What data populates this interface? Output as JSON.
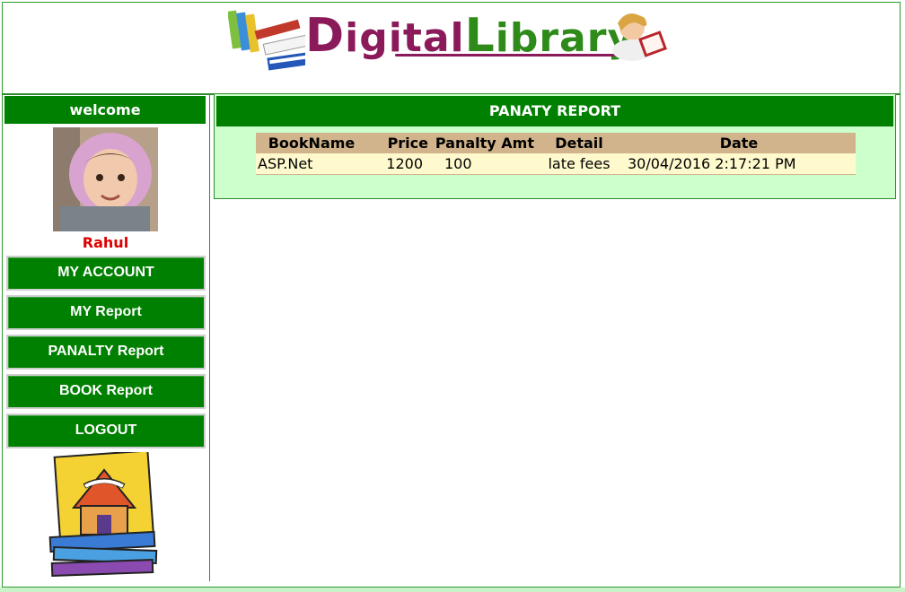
{
  "header": {
    "logo_part1_initial": "D",
    "logo_part1_rest": "igital",
    "logo_part2_initial": "L",
    "logo_part2_rest": "ibrary"
  },
  "sidebar": {
    "welcome": "welcome",
    "username": "Rahul",
    "nav": [
      {
        "label": "MY ACCOUNT"
      },
      {
        "label": "MY Report"
      },
      {
        "label": "PANALTY Report"
      },
      {
        "label": "BOOK Report"
      },
      {
        "label": "LOGOUT"
      }
    ]
  },
  "main": {
    "title": "PANATY REPORT",
    "table": {
      "headers": [
        "BookName",
        "Price",
        "Panalty Amt",
        "Detail",
        "Date"
      ],
      "rows": [
        [
          "ASP.Net",
          "1200",
          "100",
          "late fees",
          "30/04/2016 2:17:21 PM"
        ]
      ]
    }
  },
  "colors": {
    "accent_green": "#008000",
    "panel_bg": "#ccffcc",
    "table_header": "#d2b48c",
    "table_row": "#fffacd",
    "username_red": "#e00000",
    "logo_purple": "#8b1a5a",
    "logo_green": "#2e8b1a"
  }
}
